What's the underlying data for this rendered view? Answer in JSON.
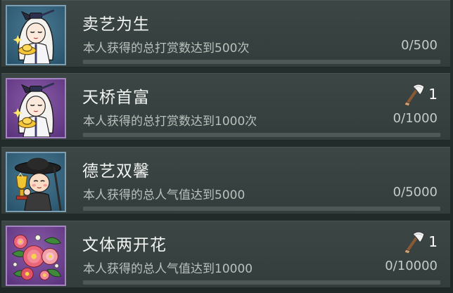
{
  "achievements": [
    {
      "title": "卖艺为生",
      "description": "本人获得的总打赏数达到500次",
      "progress_text": "0/500",
      "progress": 0,
      "icon": "scholar-with-gold-ingot-icon",
      "reward": null
    },
    {
      "title": "天桥首富",
      "description": "本人获得的总打赏数达到1000次",
      "progress_text": "0/1000",
      "progress": 0,
      "icon": "scholar-with-gold-ingot-icon",
      "reward": {
        "icon": "axe-icon",
        "count": "1"
      }
    },
    {
      "title": "德艺双馨",
      "description": "本人获得的总人气值达到5000",
      "progress_text": "0/5000",
      "progress": 0,
      "icon": "performer-with-trophy-icon",
      "reward": null
    },
    {
      "title": "文体两开花",
      "description": "本人获得的总人气值达到10000",
      "progress_text": "0/10000",
      "progress": 0,
      "icon": "flower-bouquet-icon",
      "reward": {
        "icon": "axe-icon",
        "count": "1"
      }
    }
  ],
  "colors": {
    "background": "#26302f",
    "row": "#3a4443",
    "progress_fill": "#c9a86a",
    "progress_track": "#4f5857"
  }
}
